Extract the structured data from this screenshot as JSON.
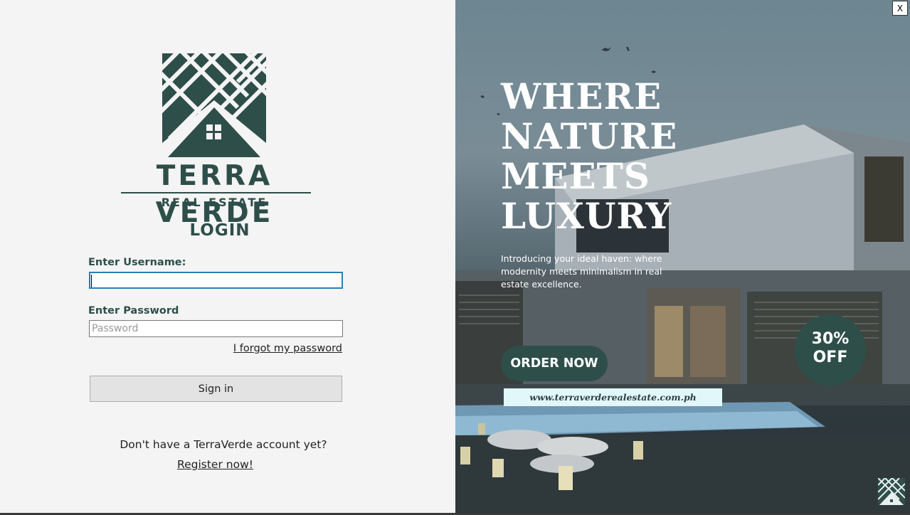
{
  "brand": {
    "name": "TERRA VERDE",
    "subtitle": "REAL ESTATE",
    "logo_icon": "house-lattice-logo-icon"
  },
  "login": {
    "title": "LOGIN",
    "username_label": "Enter Username:",
    "username_value": "",
    "password_label": "Enter Password",
    "password_placeholder": "Password",
    "forgot_link": "I forgot my password",
    "signin_button": "Sign in",
    "no_account_text": "Don't have a TerraVerde account yet?",
    "register_link": "Register now!"
  },
  "promo": {
    "headline": [
      "WHERE",
      "NATURE",
      "MEETS",
      "LUXURY"
    ],
    "intro": "Introducing your ideal haven: where modernity meets minimalism in real estate excellence.",
    "order_button": "ORDER NOW",
    "website": "www.terraverderealestate.com.ph",
    "discount_percent": "30%",
    "discount_label": "OFF"
  },
  "window": {
    "close_label": "X"
  },
  "colors": {
    "brand_green": "#2e4e4a",
    "panel_bg": "#f4f4f4",
    "url_bg": "#e2f7fa"
  }
}
